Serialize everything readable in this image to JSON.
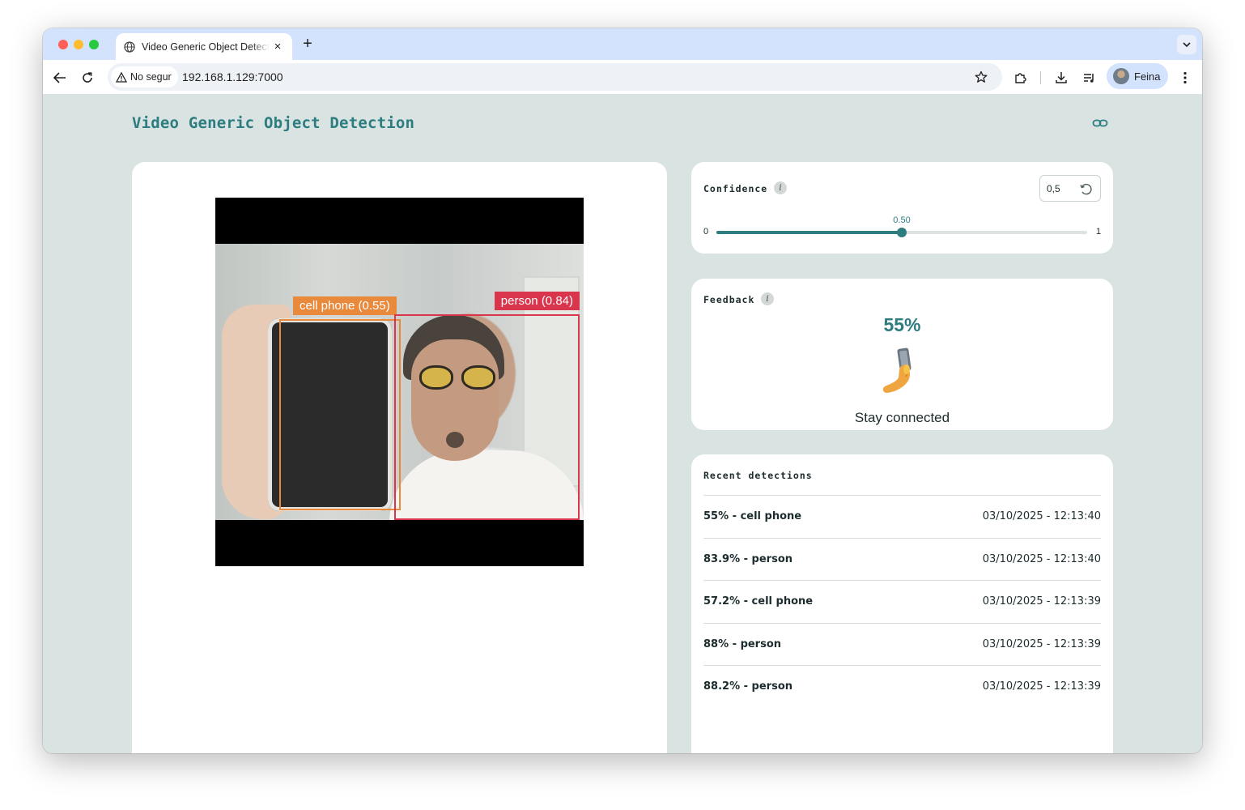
{
  "browser": {
    "tab_title": "Video Generic Object Detection",
    "close_glyph": "×",
    "new_tab_glyph": "+",
    "security_label": "No segur",
    "url": "192.168.1.129:7000",
    "profile_name": "Feina"
  },
  "page": {
    "title": "Video Generic Object Detection",
    "link_icon": "infinity-link-icon"
  },
  "video": {
    "detections": [
      {
        "label": "cell phone (0.55)",
        "color": "#e8893b"
      },
      {
        "label": "person (0.84)",
        "color": "#d9354d"
      }
    ]
  },
  "confidence": {
    "label": "Confidence",
    "info_glyph": "i",
    "input_value": "0,5",
    "min_label": "0",
    "max_label": "1",
    "value": 0.5,
    "value_label": "0.50",
    "accent": "#2d7d80"
  },
  "feedback": {
    "label": "Feedback",
    "info_glyph": "i",
    "percent": "55%",
    "emoji": "selfie-hand-phone-emoji",
    "message": "Stay connected"
  },
  "recent": {
    "label": "Recent detections",
    "items": [
      {
        "label": "55% - cell phone",
        "time": "03/10/2025 - 12:13:40"
      },
      {
        "label": "83.9% - person",
        "time": "03/10/2025 - 12:13:40"
      },
      {
        "label": "57.2% - cell phone",
        "time": "03/10/2025 - 12:13:39"
      },
      {
        "label": "88% - person",
        "time": "03/10/2025 - 12:13:39"
      },
      {
        "label": "88.2% - person",
        "time": "03/10/2025 - 12:13:39"
      }
    ]
  }
}
